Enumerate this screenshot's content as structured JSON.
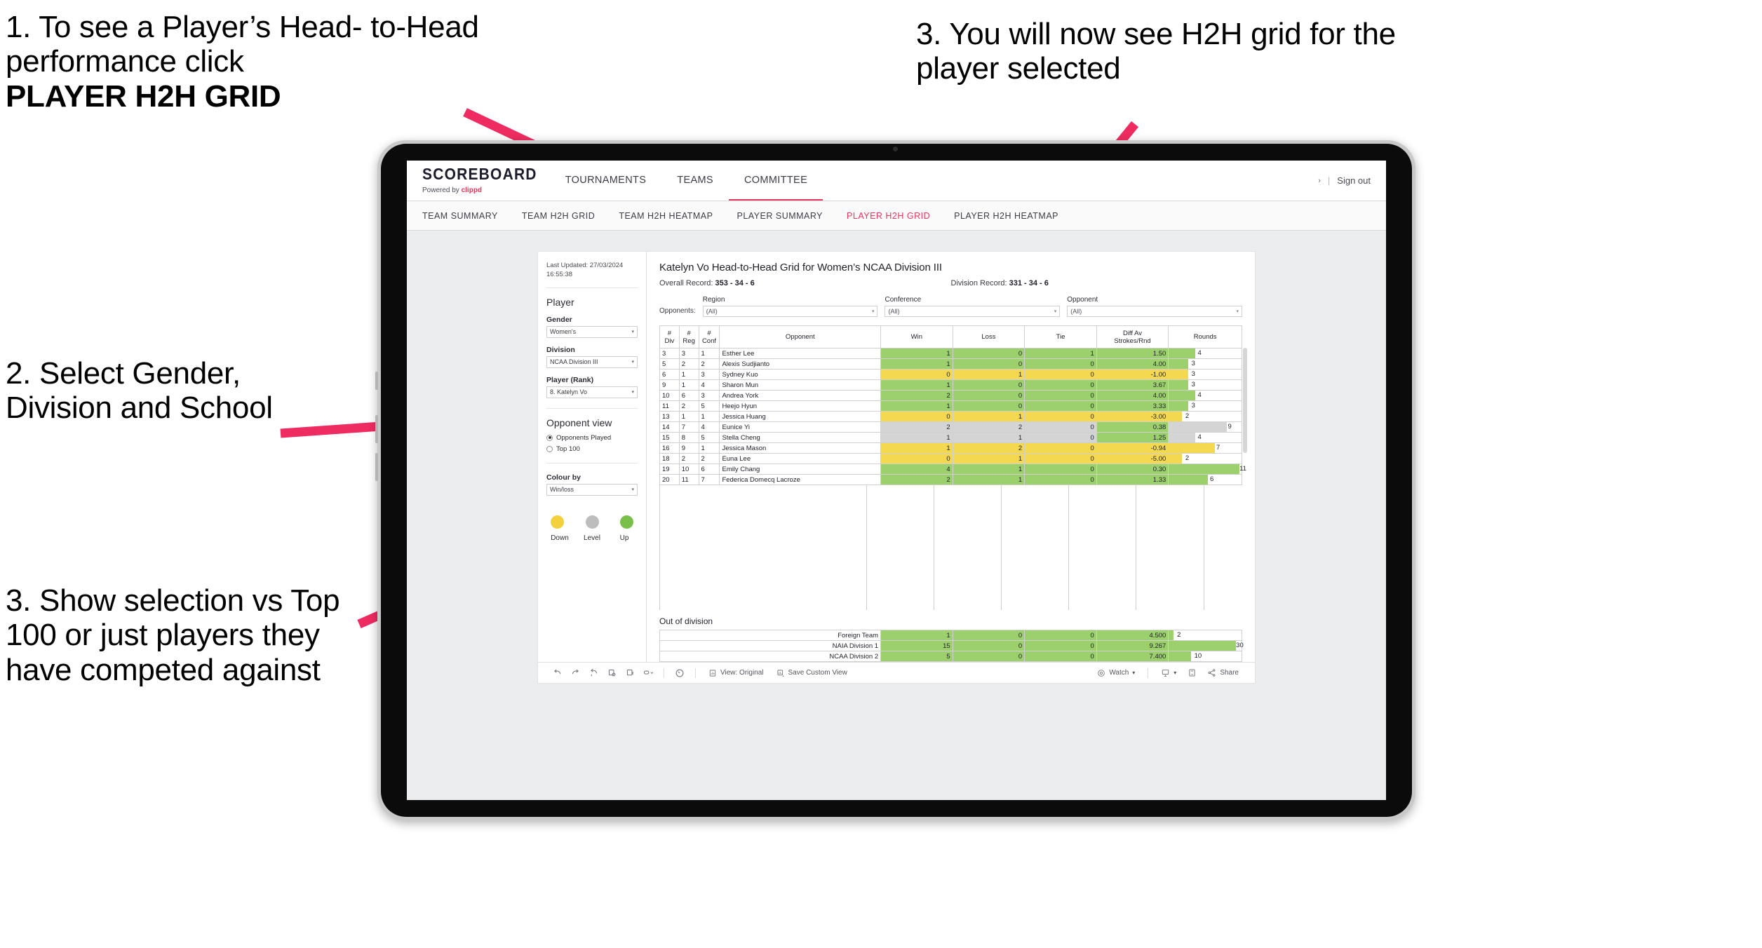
{
  "annotations": {
    "step1_line1": "1. To see a Player’s Head-",
    "step1_line2": "to-Head performance click",
    "step1_bold": "PLAYER H2H GRID",
    "step2": "2. Select Gender, Division and School",
    "step3_left": "3. Show selection vs Top 100 or just players they have competed against",
    "step3_right": "3. You will now see H2H grid for the player selected",
    "arrow_color": "#ee2c62"
  },
  "header": {
    "brand_title": "SCOREBOARD",
    "brand_sub_prefix": "Powered by ",
    "brand_sub_mark": "clippd",
    "nav": [
      {
        "label": "TOURNAMENTS",
        "active": false
      },
      {
        "label": "TEAMS",
        "active": false
      },
      {
        "label": "COMMITTEE",
        "active": true
      }
    ],
    "user_chevron": "›",
    "separator": "|",
    "sign_out": "Sign out"
  },
  "subnav": [
    {
      "label": "TEAM SUMMARY",
      "active": false
    },
    {
      "label": "TEAM H2H GRID",
      "active": false
    },
    {
      "label": "TEAM H2H HEATMAP",
      "active": false
    },
    {
      "label": "PLAYER SUMMARY",
      "active": false
    },
    {
      "label": "PLAYER H2H GRID",
      "active": true
    },
    {
      "label": "PLAYER H2H HEATMAP",
      "active": false
    }
  ],
  "filters": {
    "last_updated": "Last Updated: 27/03/2024 16:55:38",
    "section_title": "Player",
    "gender_label": "Gender",
    "gender_value": "Women's",
    "division_label": "Division",
    "division_value": "NCAA Division III",
    "player_label": "Player (Rank)",
    "player_value": "8. Katelyn Vo",
    "opponent_view_title": "Opponent view",
    "opponent_view_options": [
      {
        "label": "Opponents Played",
        "selected": true
      },
      {
        "label": "Top 100",
        "selected": false
      }
    ],
    "colour_by_label": "Colour by",
    "colour_by_value": "Win/loss",
    "legend": [
      {
        "label": "Down",
        "color": "#f2d13c"
      },
      {
        "label": "Level",
        "color": "#bdbdbd"
      },
      {
        "label": "Up",
        "color": "#78c04a"
      }
    ],
    "caret": "▾"
  },
  "viz": {
    "title": "Katelyn Vo Head-to-Head Grid for Women’s NCAA Division III",
    "overall_record_label": "Overall Record: ",
    "overall_record_value": "353 - 34 - 6",
    "division_record_label": "Division Record: ",
    "division_record_value": "331 - 34 - 6",
    "opponents_label": "Opponents:",
    "opponent_filters": [
      {
        "caption": "Region",
        "value": "(All)"
      },
      {
        "caption": "Conference",
        "value": "(All)"
      },
      {
        "caption": "Opponent",
        "value": "(All)"
      }
    ],
    "out_of_division_title": "Out of division"
  },
  "chart_data": {
    "type": "table",
    "title": "Katelyn Vo Head-to-Head Grid for Women’s NCAA Division III",
    "columns": [
      "# Div",
      "# Reg",
      "# Conf",
      "Opponent",
      "Win",
      "Loss",
      "Tie",
      "Diff Av Strokes/Rnd",
      "Rounds"
    ],
    "column_header_lines": [
      [
        "#",
        "Div"
      ],
      [
        "#",
        "Reg"
      ],
      [
        "#",
        "Conf"
      ],
      [
        "Opponent"
      ],
      [
        "Win"
      ],
      [
        "Loss"
      ],
      [
        "Tie"
      ],
      [
        "Diff Av",
        "Strokes/Rnd"
      ],
      [
        "Rounds"
      ]
    ],
    "rows": [
      {
        "div": "3",
        "reg": "3",
        "conf": "1",
        "opponent": "Esther Lee",
        "win": "1",
        "loss": "0",
        "tie": "1",
        "diff": "1.50",
        "rounds": "4",
        "state": "up",
        "rounds_pct": 36
      },
      {
        "div": "5",
        "reg": "2",
        "conf": "2",
        "opponent": "Alexis Sudjianto",
        "win": "1",
        "loss": "0",
        "tie": "0",
        "diff": "4.00",
        "rounds": "3",
        "state": "up",
        "rounds_pct": 27
      },
      {
        "div": "6",
        "reg": "1",
        "conf": "3",
        "opponent": "Sydney Kuo",
        "win": "0",
        "loss": "1",
        "tie": "0",
        "diff": "-1.00",
        "rounds": "3",
        "state": "down",
        "rounds_pct": 27
      },
      {
        "div": "9",
        "reg": "1",
        "conf": "4",
        "opponent": "Sharon Mun",
        "win": "1",
        "loss": "0",
        "tie": "0",
        "diff": "3.67",
        "rounds": "3",
        "state": "up",
        "rounds_pct": 27
      },
      {
        "div": "10",
        "reg": "6",
        "conf": "3",
        "opponent": "Andrea York",
        "win": "2",
        "loss": "0",
        "tie": "0",
        "diff": "4.00",
        "rounds": "4",
        "state": "up",
        "rounds_pct": 36
      },
      {
        "div": "11",
        "reg": "2",
        "conf": "5",
        "opponent": "Heejo Hyun",
        "win": "1",
        "loss": "0",
        "tie": "0",
        "diff": "3.33",
        "rounds": "3",
        "state": "up",
        "rounds_pct": 27
      },
      {
        "div": "13",
        "reg": "1",
        "conf": "1",
        "opponent": "Jessica Huang",
        "win": "0",
        "loss": "1",
        "tie": "0",
        "diff": "-3.00",
        "rounds": "2",
        "state": "down",
        "rounds_pct": 18
      },
      {
        "div": "14",
        "reg": "7",
        "conf": "4",
        "opponent": "Eunice Yi",
        "win": "2",
        "loss": "2",
        "tie": "0",
        "diff": "0.38",
        "rounds": "9",
        "state": "level",
        "rounds_pct": 80
      },
      {
        "div": "15",
        "reg": "8",
        "conf": "5",
        "opponent": "Stella Cheng",
        "win": "1",
        "loss": "1",
        "tie": "0",
        "diff": "1.25",
        "rounds": "4",
        "state": "level",
        "rounds_pct": 36
      },
      {
        "div": "16",
        "reg": "9",
        "conf": "1",
        "opponent": "Jessica Mason",
        "win": "1",
        "loss": "2",
        "tie": "0",
        "diff": "-0.94",
        "rounds": "7",
        "state": "down",
        "rounds_pct": 63
      },
      {
        "div": "18",
        "reg": "2",
        "conf": "2",
        "opponent": "Euna Lee",
        "win": "0",
        "loss": "1",
        "tie": "0",
        "diff": "-5.00",
        "rounds": "2",
        "state": "down",
        "rounds_pct": 18
      },
      {
        "div": "19",
        "reg": "10",
        "conf": "6",
        "opponent": "Emily Chang",
        "win": "4",
        "loss": "1",
        "tie": "0",
        "diff": "0.30",
        "rounds": "11",
        "state": "up",
        "rounds_pct": 97
      },
      {
        "div": "20",
        "reg": "11",
        "conf": "7",
        "opponent": "Federica Domecq Lacroze",
        "win": "2",
        "loss": "1",
        "tie": "0",
        "diff": "1.33",
        "rounds": "6",
        "state": "up",
        "rounds_pct": 54
      }
    ],
    "out_of_division_rows": [
      {
        "name": "Foreign Team",
        "win": "1",
        "loss": "0",
        "tie": "0",
        "diff": "4.500",
        "rounds": "2",
        "state": "up",
        "rounds_pct": 6
      },
      {
        "name": "NAIA Division 1",
        "win": "15",
        "loss": "0",
        "tie": "0",
        "diff": "9.267",
        "rounds": "30",
        "state": "up",
        "rounds_pct": 92
      },
      {
        "name": "NCAA Division 2",
        "win": "5",
        "loss": "0",
        "tie": "0",
        "diff": "7.400",
        "rounds": "10",
        "state": "up",
        "rounds_pct": 31
      }
    ],
    "state_colors": {
      "up": "#9bd06c",
      "down": "#f4d84f",
      "level": "#d4d4d4"
    }
  },
  "toolbar": {
    "view_label": "View: Original",
    "save_label": "Save Custom View",
    "watch_label": "Watch",
    "share_label": "Share",
    "caret": "▾"
  }
}
